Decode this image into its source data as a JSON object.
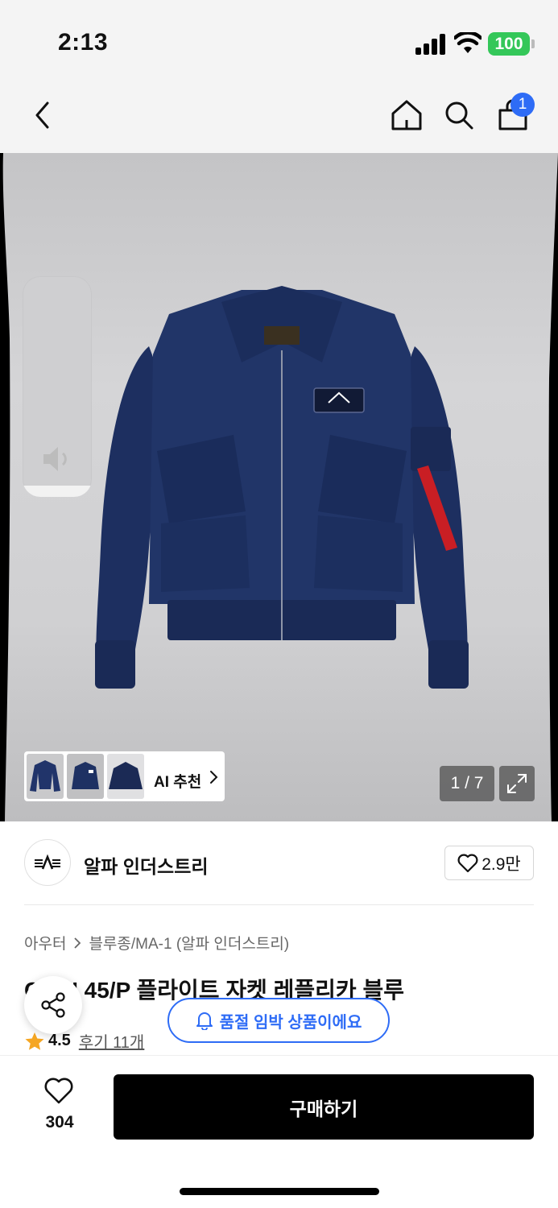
{
  "status_bar": {
    "time": "2:13",
    "battery": "100"
  },
  "nav": {
    "cart_count": "1",
    "icons": [
      "back-icon",
      "home-icon",
      "search-icon",
      "cart-icon"
    ]
  },
  "gallery": {
    "page_counter": "1 / 7",
    "ai_recommend_label": "AI 추천",
    "volume_level": 0.05
  },
  "brand": {
    "name": "알파 인더스트리",
    "likes": "2.9만"
  },
  "breadcrumb": {
    "category": "아우터",
    "subcategory": "블루종/MA-1 (알파 인더스트리)"
  },
  "product": {
    "title": "CWU 45/P 플라이트 자켓 레플리카 블루",
    "rating": "4.5",
    "reviews": "후기 11개"
  },
  "toast": {
    "message": "품절 임박 상품이에요"
  },
  "bottom": {
    "wish_count": "304",
    "buy_label": "구매하기"
  },
  "colors": {
    "accent": "#2e6cf6",
    "battery": "#34c759",
    "star": "#f5a623",
    "jacket": "#1e3163"
  }
}
